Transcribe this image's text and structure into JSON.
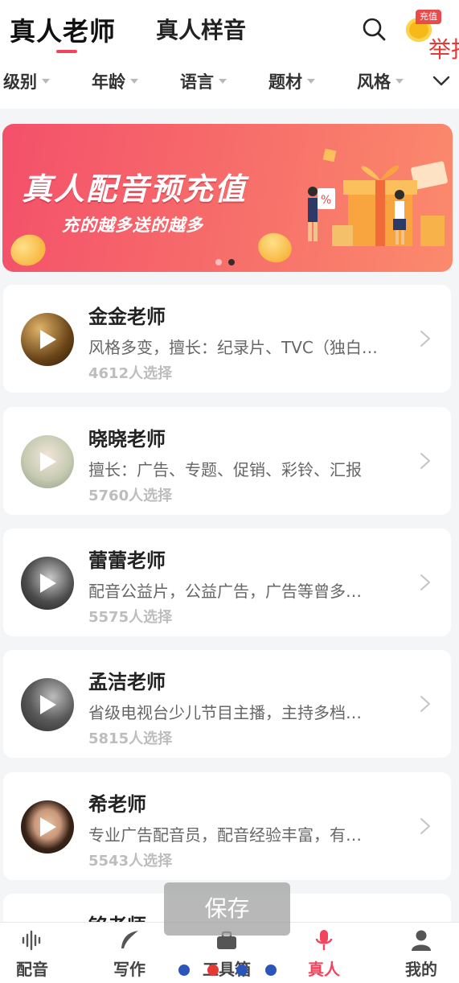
{
  "header": {
    "tab_main": "真人老师",
    "tab_second": "真人样音",
    "recharge_badge": "充值",
    "report_text": "举报"
  },
  "filters": [
    {
      "label": "级别"
    },
    {
      "label": "年龄"
    },
    {
      "label": "语言"
    },
    {
      "label": "题材"
    },
    {
      "label": "风格"
    }
  ],
  "banner": {
    "title": "真人配音预充值",
    "subtitle": "充的越多送的越多",
    "slide_count": 2,
    "active_slide": 2
  },
  "teachers": [
    {
      "name": "金金老师",
      "desc": "风格多变，擅长：纪录片、TVC（独白…",
      "count": "4612人选择"
    },
    {
      "name": "晓晓老师",
      "desc": "擅长：广告、专题、促销、彩铃、汇报",
      "count": "5760人选择"
    },
    {
      "name": "蕾蕾老师",
      "desc": "配音公益片，公益广告，广告等曾多…",
      "count": "5575人选择"
    },
    {
      "name": "孟洁老师",
      "desc": "省级电视台少儿节目主播，主持多档…",
      "count": "5815人选择"
    },
    {
      "name": "希老师",
      "desc": "专业广告配音员，配音经验丰富，有…",
      "count": "5543人选择"
    },
    {
      "name": "铭老师",
      "desc": "",
      "count": ""
    }
  ],
  "bottom_nav": [
    {
      "label": "配音",
      "icon": "waveform-icon"
    },
    {
      "label": "写作",
      "icon": "feather-icon"
    },
    {
      "label": "工具箱",
      "icon": "toolbox-icon"
    },
    {
      "label": "真人",
      "icon": "microphone-icon",
      "active": true
    },
    {
      "label": "我的",
      "icon": "person-icon"
    }
  ],
  "overlay": {
    "save_label": "保存"
  },
  "colors": {
    "accent": "#f0455d",
    "banner": "#f4506a",
    "report": "#e53935",
    "recharge": "#e94a4a"
  }
}
